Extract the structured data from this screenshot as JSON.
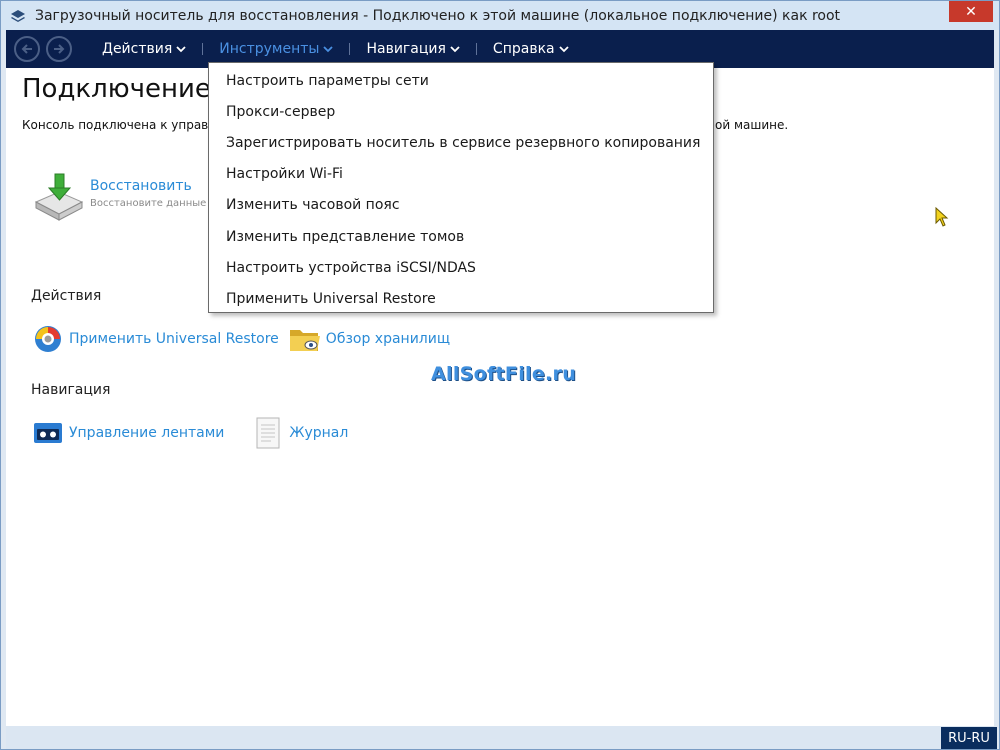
{
  "window": {
    "title": "Загрузочный носитель для восстановления - Подключено к этой машине (локальное подключение) как root",
    "close_label": "✕"
  },
  "menubar": {
    "items": [
      {
        "label": "Действия"
      },
      {
        "label": "Инструменты"
      },
      {
        "label": "Навигация"
      },
      {
        "label": "Справка"
      }
    ],
    "active_index": 1
  },
  "page": {
    "title": "Подключение к т",
    "description": "Консоль подключена к управляем",
    "description_tail": "ой машине."
  },
  "restore": {
    "title": "Восстановить",
    "subtitle": "Восстановите данные из"
  },
  "actions": {
    "heading": "Действия",
    "links": [
      {
        "label": "Применить Universal Restore",
        "icon": "universal-restore-icon"
      },
      {
        "label": "Обзор хранилищ",
        "icon": "folder-browse-icon"
      }
    ]
  },
  "navigation": {
    "heading": "Навигация",
    "links": [
      {
        "label": "Управление лентами",
        "icon": "tape-icon"
      },
      {
        "label": "Журнал",
        "icon": "log-icon"
      }
    ]
  },
  "tools_menu": {
    "items": [
      {
        "label": "Настроить параметры сети"
      },
      {
        "label": "Прокси-сервер"
      },
      {
        "label": "Зарегистрировать носитель в сервисе резервного копирования"
      },
      {
        "label": "Настройки Wi-Fi"
      },
      {
        "label": "Изменить часовой пояс"
      },
      {
        "label": "Изменить представление томов"
      },
      {
        "label": "Настроить устройства iSCSI/NDAS"
      },
      {
        "label": "Применить Universal Restore"
      }
    ]
  },
  "watermark": "AllSoftFile.ru",
  "statusbar": {
    "language": "RU-RU"
  },
  "colors": {
    "menubar_bg": "#0a1f4d",
    "link_blue": "#2a8bd6",
    "active_menu": "#4a90e2",
    "close_red": "#c7392b"
  }
}
